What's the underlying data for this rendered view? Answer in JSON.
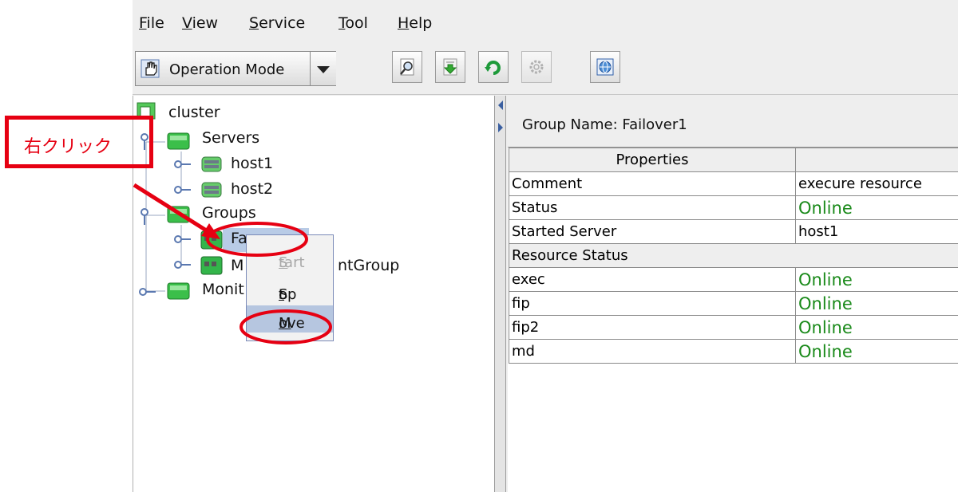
{
  "menubar": {
    "items": [
      {
        "mnemonic": "F",
        "rest": "ile"
      },
      {
        "mnemonic": "V",
        "rest": "iew"
      },
      {
        "mnemonic": "S",
        "rest": "ervice"
      },
      {
        "mnemonic": "T",
        "rest": "ool"
      },
      {
        "mnemonic": "H",
        "rest": "elp"
      }
    ]
  },
  "toolbar": {
    "mode_label": "Operation Mode"
  },
  "tree": {
    "root": "cluster",
    "servers": "Servers",
    "host1": "host1",
    "host2": "host2",
    "groups": "Groups",
    "failover_partial": "Fa",
    "mgmt_prefix": "M",
    "mgmt_suffix": "ntGroup",
    "monitors_partial": "Monit"
  },
  "right_pane": {
    "group_name": "Group Name: Failover1",
    "header": "Properties",
    "rows": [
      {
        "label": "Comment",
        "value": "execure resource"
      },
      {
        "label": "Status",
        "value": "Online"
      },
      {
        "label": "Started Server",
        "value": "host1"
      }
    ],
    "resource_section": "Resource Status",
    "resources": [
      {
        "name": "exec",
        "status": "Online"
      },
      {
        "name": "fip",
        "status": "Online"
      },
      {
        "name": "fip2",
        "status": "Online"
      },
      {
        "name": "md",
        "status": "Online"
      }
    ]
  },
  "context_menu": {
    "start": {
      "mnemonic": "S",
      "rest": "tart"
    },
    "stop": {
      "pre": "S",
      "mnemonic": "t",
      "rest": "op"
    },
    "move": {
      "mnemonic": "M",
      "rest": "ove"
    }
  },
  "annotation": {
    "label": "右クリック",
    "color": "#e60012"
  }
}
